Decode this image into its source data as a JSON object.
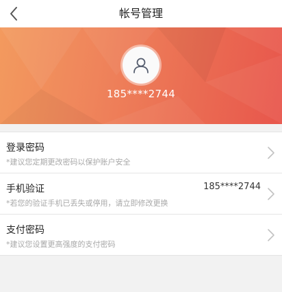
{
  "nav": {
    "back_icon": "chevron-left-icon",
    "title": "帐号管理"
  },
  "profile": {
    "avatar_icon": "user-icon",
    "phone": "185****2744",
    "banner_colors": [
      "#f39a5e",
      "#e8564c"
    ]
  },
  "settings": [
    {
      "title": "登录密码",
      "subtitle": "*建议您定期更改密码以保护账户安全",
      "value": ""
    },
    {
      "title": "手机验证",
      "subtitle": "*若您的验证手机已丢失或停用，请立即修改更换",
      "value": "185****2744"
    },
    {
      "title": "支付密码",
      "subtitle": "*建议您设置更高强度的支付密码",
      "value": ""
    }
  ]
}
